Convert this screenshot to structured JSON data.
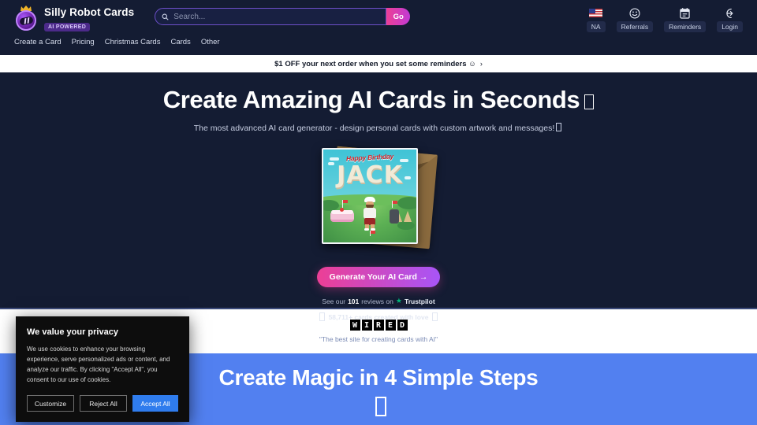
{
  "header": {
    "brand_name": "Silly Robot Cards",
    "badge": "AI POWERED",
    "logo_icon": "robot-crown-logo",
    "search": {
      "placeholder": "Search...",
      "value": "",
      "icon": "search-icon",
      "go_label": "Go"
    },
    "actions": [
      {
        "icon": "us-flag-icon",
        "label": "NA"
      },
      {
        "icon": "smiley-face-icon",
        "label": "Referrals"
      },
      {
        "icon": "calendar-clipboard-icon",
        "label": "Reminders"
      },
      {
        "icon": "login-arrow-icon",
        "label": "Login"
      }
    ],
    "nav": [
      {
        "label": "Create a Card"
      },
      {
        "label": "Pricing"
      },
      {
        "label": "Christmas Cards"
      },
      {
        "label": "Cards"
      },
      {
        "label": "Other"
      }
    ]
  },
  "promo": {
    "text": "$1 OFF your next order when you set some reminders ☺",
    "chevron": "›"
  },
  "hero": {
    "headline": "Create Amazing AI Cards in Seconds",
    "headline_emoji": "missing-glyph-box",
    "subheadline": "The most advanced AI card generator - design personal cards with custom artwork and messages!",
    "subheadline_emoji": "missing-glyph-box",
    "card_preview": {
      "greeting": "Happy Birthday",
      "name": "JACK",
      "alt": "birthday card with golf course scene"
    },
    "cta_label": "Generate Your AI Card",
    "cta_arrow": "→",
    "trust": {
      "prefix": "See our",
      "count": "101",
      "middle": "reviews on",
      "star": "★",
      "brand": "Trustpilot"
    },
    "cards_made": "58,711+ cards created with love"
  },
  "press": {
    "logo_letters": [
      "W",
      "I",
      "R",
      "E",
      "D"
    ],
    "quote": "\"The best site for creating cards with AI\""
  },
  "steps": {
    "title": "Create Magic in 4 Simple Steps",
    "emoji": "missing-glyph-box"
  },
  "cookie": {
    "title": "We value your privacy",
    "body": "We use cookies to enhance your browsing experience, serve personalized ads or content, and analyze our traffic. By clicking \"Accept All\", you consent to our use of cookies.",
    "customize_label": "Customize",
    "reject_label": "Reject All",
    "accept_label": "Accept All"
  },
  "colors": {
    "hero_bg": "#141c33",
    "accent_pink": "#ec3f95",
    "accent_purple": "#a855f7",
    "steps_blue": "#5280f0",
    "cookie_accept": "#2f7ced",
    "trustpilot_green": "#00b67a"
  }
}
